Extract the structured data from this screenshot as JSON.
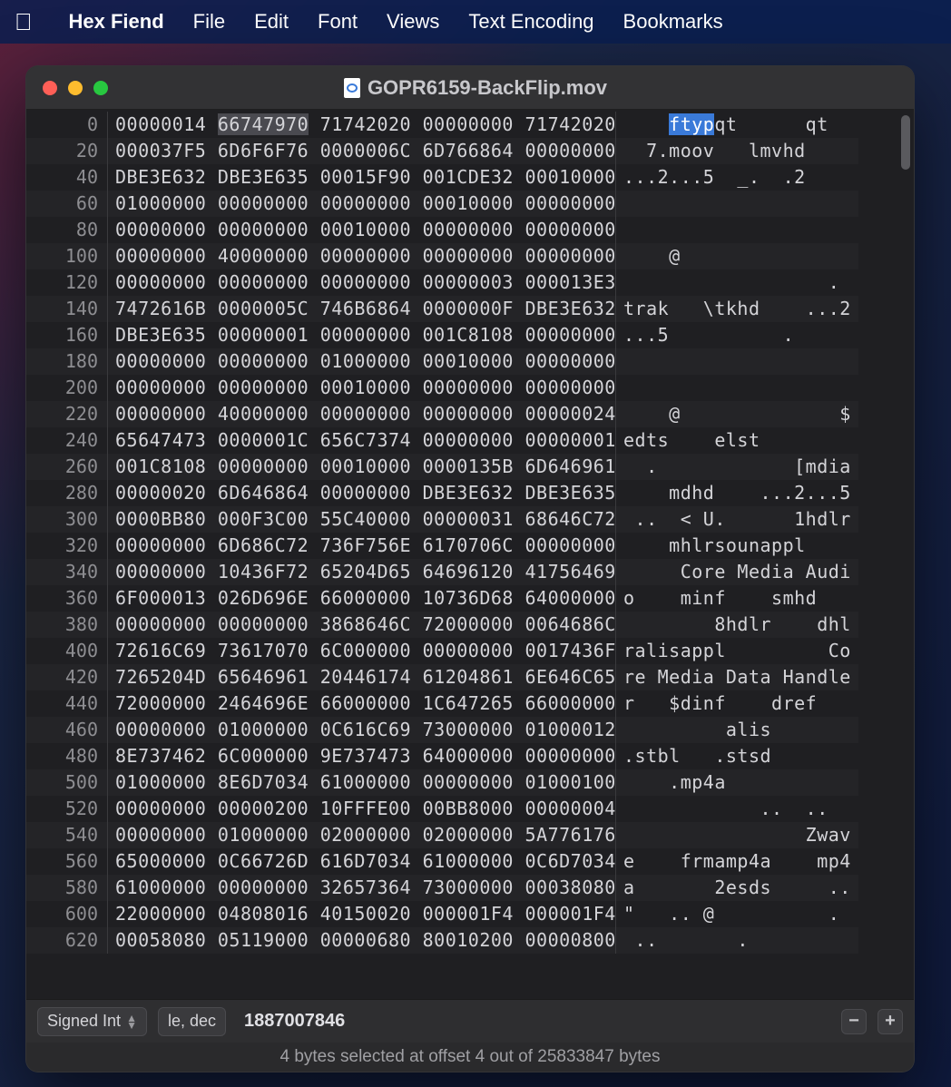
{
  "menubar": {
    "app": "Hex Fiend",
    "items": [
      "File",
      "Edit",
      "Font",
      "Views",
      "Text Encoding",
      "Bookmarks"
    ]
  },
  "window": {
    "title": "GOPR6159-BackFlip.mov"
  },
  "rows": [
    {
      "off": "0",
      "hex": [
        "00000014",
        "66747970",
        "71742020",
        "00000000",
        "71742020"
      ],
      "ascii": "    ftypqt      qt  ",
      "selHex": 1,
      "selAsc": [
        4,
        8
      ]
    },
    {
      "off": "20",
      "hex": [
        "000037F5",
        "6D6F6F76",
        "0000006C",
        "6D766864",
        "00000000"
      ],
      "ascii": "  7.moov   lmvhd    "
    },
    {
      "off": "40",
      "hex": [
        "DBE3E632",
        "DBE3E635",
        "00015F90",
        "001CDE32",
        "00010000"
      ],
      "ascii": "...2...5  _.  .2    "
    },
    {
      "off": "60",
      "hex": [
        "01000000",
        "00000000",
        "00000000",
        "00010000",
        "00000000"
      ],
      "ascii": "                    "
    },
    {
      "off": "80",
      "hex": [
        "00000000",
        "00000000",
        "00010000",
        "00000000",
        "00000000"
      ],
      "ascii": "                    "
    },
    {
      "off": "100",
      "hex": [
        "00000000",
        "40000000",
        "00000000",
        "00000000",
        "00000000"
      ],
      "ascii": "    @               "
    },
    {
      "off": "120",
      "hex": [
        "00000000",
        "00000000",
        "00000000",
        "00000003",
        "000013E3"
      ],
      "ascii": "                  . "
    },
    {
      "off": "140",
      "hex": [
        "7472616B",
        "0000005C",
        "746B6864",
        "0000000F",
        "DBE3E632"
      ],
      "ascii": "trak   \\tkhd    ...2"
    },
    {
      "off": "160",
      "hex": [
        "DBE3E635",
        "00000001",
        "00000000",
        "001C8108",
        "00000000"
      ],
      "ascii": "...5          .     "
    },
    {
      "off": "180",
      "hex": [
        "00000000",
        "00000000",
        "01000000",
        "00010000",
        "00000000"
      ],
      "ascii": "                    "
    },
    {
      "off": "200",
      "hex": [
        "00000000",
        "00000000",
        "00010000",
        "00000000",
        "00000000"
      ],
      "ascii": "                    "
    },
    {
      "off": "220",
      "hex": [
        "00000000",
        "40000000",
        "00000000",
        "00000000",
        "00000024"
      ],
      "ascii": "    @              $"
    },
    {
      "off": "240",
      "hex": [
        "65647473",
        "0000001C",
        "656C7374",
        "00000000",
        "00000001"
      ],
      "ascii": "edts    elst        "
    },
    {
      "off": "260",
      "hex": [
        "001C8108",
        "00000000",
        "00010000",
        "0000135B",
        "6D646961"
      ],
      "ascii": "  .            [mdia"
    },
    {
      "off": "280",
      "hex": [
        "00000020",
        "6D646864",
        "00000000",
        "DBE3E632",
        "DBE3E635"
      ],
      "ascii": "    mdhd    ...2...5"
    },
    {
      "off": "300",
      "hex": [
        "0000BB80",
        "000F3C00",
        "55C40000",
        "00000031",
        "68646C72"
      ],
      "ascii": " ..  < U.      1hdlr"
    },
    {
      "off": "320",
      "hex": [
        "00000000",
        "6D686C72",
        "736F756E",
        "6170706C",
        "00000000"
      ],
      "ascii": "    mhlrsounappl    "
    },
    {
      "off": "340",
      "hex": [
        "00000000",
        "10436F72",
        "65204D65",
        "64696120",
        "41756469"
      ],
      "ascii": "     Core Media Audi"
    },
    {
      "off": "360",
      "hex": [
        "6F000013",
        "026D696E",
        "66000000",
        "10736D68",
        "64000000"
      ],
      "ascii": "o    minf    smhd   "
    },
    {
      "off": "380",
      "hex": [
        "00000000",
        "00000000",
        "3868646C",
        "72000000",
        "0064686C"
      ],
      "ascii": "        8hdlr    dhl"
    },
    {
      "off": "400",
      "hex": [
        "72616C69",
        "73617070",
        "6C000000",
        "00000000",
        "0017436F"
      ],
      "ascii": "ralisappl         Co"
    },
    {
      "off": "420",
      "hex": [
        "7265204D",
        "65646961",
        "20446174",
        "61204861",
        "6E646C65"
      ],
      "ascii": "re Media Data Handle"
    },
    {
      "off": "440",
      "hex": [
        "72000000",
        "2464696E",
        "66000000",
        "1C647265",
        "66000000"
      ],
      "ascii": "r   $dinf    dref   "
    },
    {
      "off": "460",
      "hex": [
        "00000000",
        "01000000",
        "0C616C69",
        "73000000",
        "01000012"
      ],
      "ascii": "         alis       "
    },
    {
      "off": "480",
      "hex": [
        "8E737462",
        "6C000000",
        "9E737473",
        "64000000",
        "00000000"
      ],
      "ascii": ".stbl   .stsd       "
    },
    {
      "off": "500",
      "hex": [
        "01000000",
        "8E6D7034",
        "61000000",
        "00000000",
        "01000100"
      ],
      "ascii": "    .mp4a           "
    },
    {
      "off": "520",
      "hex": [
        "00000000",
        "00000200",
        "10FFFE00",
        "00BB8000",
        "00000004"
      ],
      "ascii": "            ..  ..  "
    },
    {
      "off": "540",
      "hex": [
        "00000000",
        "01000000",
        "02000000",
        "02000000",
        "5A776176"
      ],
      "ascii": "                Zwav"
    },
    {
      "off": "560",
      "hex": [
        "65000000",
        "0C66726D",
        "616D7034",
        "61000000",
        "0C6D7034"
      ],
      "ascii": "e    frmamp4a    mp4"
    },
    {
      "off": "580",
      "hex": [
        "61000000",
        "00000000",
        "32657364",
        "73000000",
        "00038080"
      ],
      "ascii": "a       2esds     .."
    },
    {
      "off": "600",
      "hex": [
        "22000000",
        "04808016",
        "40150020",
        "000001F4",
        "000001F4"
      ],
      "ascii": "\"   .. @          . "
    },
    {
      "off": "620",
      "hex": [
        "00058080",
        "05119000",
        "00000680",
        "80010200",
        "00000800"
      ],
      "ascii": " ..       .         "
    }
  ],
  "bottombar": {
    "typeSelect": "Signed Int",
    "endianSelect": "le, dec",
    "value": "1887007846"
  },
  "status": "4 bytes selected at offset 4 out of 25833847 bytes"
}
